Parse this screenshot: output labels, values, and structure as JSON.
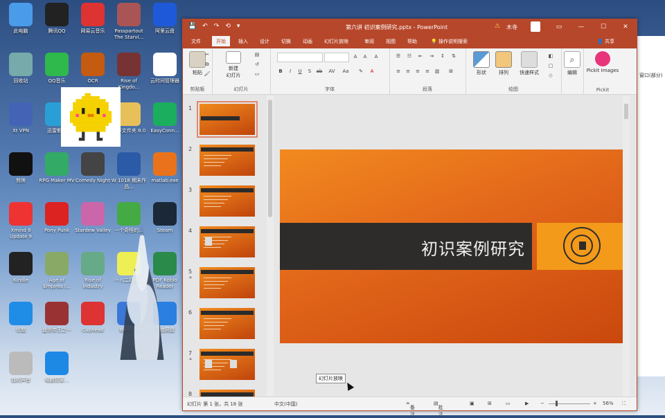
{
  "desktop": {
    "icons": [
      {
        "label": "此电脑",
        "color": "#4a9be8"
      },
      {
        "label": "腾讯QQ",
        "color": "#222"
      },
      {
        "label": "网易云音乐",
        "color": "#d33"
      },
      {
        "label": "Passpartout The Starvi...",
        "color": "#a55"
      },
      {
        "label": "阿里云盘",
        "color": "#1e5ad8"
      },
      {
        "label": "回收站",
        "color": "#7aa"
      },
      {
        "label": "QQ音乐",
        "color": "#2fb84c"
      },
      {
        "label": "OCR",
        "color": "#c55a11"
      },
      {
        "label": "Rise of Kingdo...",
        "color": "#733"
      },
      {
        "label": "云时间管理器",
        "color": "#fff"
      },
      {
        "label": "Xt VPN",
        "color": "#4463b5"
      },
      {
        "label": "迅雷影音",
        "color": "#2a9fd6"
      },
      {
        "label": "Building Publisher",
        "color": "#333"
      },
      {
        "label": "工作文件夹 8.0",
        "color": "#e8c05a"
      },
      {
        "label": "EasyConn...",
        "color": "#1bae5f"
      },
      {
        "label": "剪映",
        "color": "#111"
      },
      {
        "label": "RPG Maker MV",
        "color": "#3a6"
      },
      {
        "label": "Comedy Night",
        "color": "#444"
      },
      {
        "label": "W 1018 期末作品...",
        "color": "#2b5aa6"
      },
      {
        "label": "matlab.exe",
        "color": "#e8731c"
      },
      {
        "label": "Xmind 8 Update 9",
        "color": "#e33"
      },
      {
        "label": "Pony Punk",
        "color": "#d22"
      },
      {
        "label": "Stardew Valley",
        "color": "#c6a"
      },
      {
        "label": "一个奇怪的...",
        "color": "#4a4"
      },
      {
        "label": "Steam",
        "color": "#1b2838"
      },
      {
        "label": "Kindle",
        "color": "#222"
      },
      {
        "label": "Age of Empires I...",
        "color": "#8a6"
      },
      {
        "label": "Rise of Industry",
        "color": "#6a8"
      },
      {
        "label": "一八二四年...",
        "color": "#ee5"
      },
      {
        "label": "PDF Koblo Reader",
        "color": "#2a8a4a"
      },
      {
        "label": "优酷",
        "color": "#1f8ce6"
      },
      {
        "label": "盛世帝王之一",
        "color": "#933"
      },
      {
        "label": "Cuphead",
        "color": "#d33"
      },
      {
        "label": "Bonk! 3",
        "color": "#3a78d8"
      },
      {
        "label": "百度网盘",
        "color": "#2a7fe0"
      },
      {
        "label": "我的声音",
        "color": "#bbb"
      },
      {
        "label": "电脑管家...",
        "color": "#1e88e5"
      }
    ],
    "right_window_text": "窗口(部分)"
  },
  "ppt": {
    "title": "第六讲 初识案例研究.pptx - PowerPoint",
    "user": "木寺",
    "quick_access": [
      "💾",
      "↶",
      "↷",
      "⟲",
      "▾"
    ],
    "window_controls": [
      "▭",
      "—",
      "☐",
      "✕"
    ],
    "tabs": [
      "文件",
      "开始",
      "插入",
      "设计",
      "切换",
      "动画",
      "幻灯片放映",
      "审阅",
      "视图",
      "帮助",
      "💡 操作说明搜索"
    ],
    "share": "共享",
    "ribbon": {
      "paste": "粘贴",
      "clipboard": "剪贴板",
      "new_slide": "新建\n幻灯片",
      "slides": "幻灯片",
      "font": "字体",
      "paragraph": "段落",
      "shape": "形状",
      "arrange": "排列",
      "quick_style": "快速样式",
      "drawing": "绘图",
      "edit": "编辑",
      "pickit": "Pickit Images",
      "pickit_group": "Pickit"
    },
    "slide_numbers": [
      "1",
      "2",
      "3",
      "4",
      "5",
      "6",
      "7",
      "8"
    ],
    "slide_title": "初识案例研究",
    "status": {
      "slide_info": "幻灯片 第 1 张，共 18 张",
      "language": "中文(中国)",
      "notes": "备注",
      "comments": "批注",
      "zoom": "56%",
      "tooltip": "幻灯片放映"
    }
  }
}
